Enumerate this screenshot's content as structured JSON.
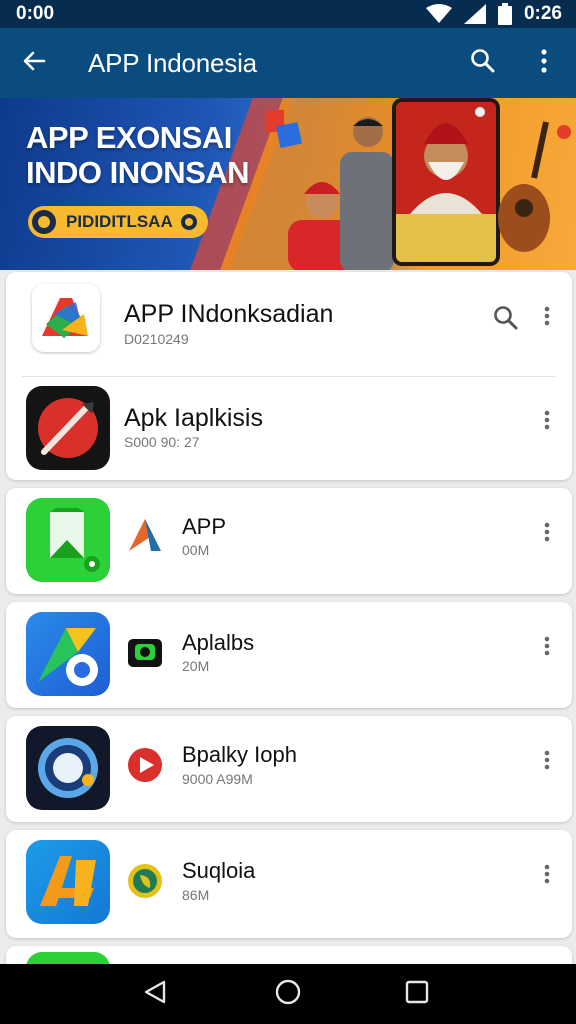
{
  "status_bar": {
    "left_time": "0:00",
    "right_time": "0:26"
  },
  "app_bar": {
    "title": "APP Indonesia"
  },
  "banner": {
    "headline_line1": "APP EXONSAI",
    "headline_line2": "INDO INONSAN",
    "pill_label": "PIDIDITLSAA"
  },
  "apps": [
    {
      "name": "APP INdonksadian",
      "meta": "D0210249"
    },
    {
      "name": "Apk Iaplkisis",
      "meta": "S000 90: 27"
    },
    {
      "name": "APP",
      "meta": "00M"
    },
    {
      "name": "Aplalbs",
      "meta": "20M"
    },
    {
      "name": "Bpalky Ioph",
      "meta": "9000 A99M"
    },
    {
      "name": "Suqloia",
      "meta": "86M"
    }
  ],
  "colors": {
    "status_bar": "#062c4f",
    "app_bar": "#0b4c7f",
    "banner_blue": "#1f56b5",
    "banner_orange": "#f39a2a"
  },
  "icons": [
    "back-arrow-icon",
    "search-icon",
    "more-vert-icon",
    "back-triangle-icon",
    "home-circle-icon",
    "recents-square-icon"
  ]
}
